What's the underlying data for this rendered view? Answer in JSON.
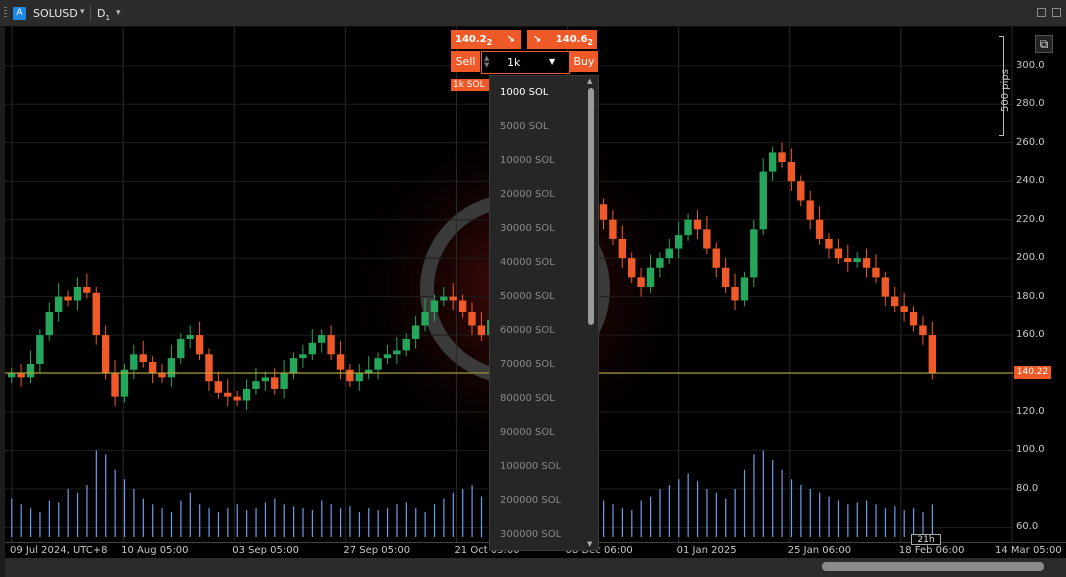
{
  "toolbar": {
    "symbol_icon": "A",
    "symbol": "SOLUSD",
    "symbol_caret": "▾",
    "timeframe": "D",
    "timeframe_sub": "1",
    "timeframe_caret": "▾"
  },
  "colors": {
    "bull": "#26a65b",
    "bear": "#f05a28",
    "volume": "#6d9ee8",
    "current_price_line": "#c6b43a",
    "accent": "#f05a28"
  },
  "trade": {
    "sell_price_main": "140.2",
    "sell_price_sub": "2",
    "buy_price_main": "140.6",
    "buy_price_sub": "2",
    "sell_label": "Sell",
    "buy_label": "Buy",
    "volume_value": "1k",
    "position_badge": "1k SOL",
    "volume_options": [
      "1000 SOL",
      "5000 SOL",
      "10000 SOL",
      "20000 SOL",
      "30000 SOL",
      "40000 SOL",
      "50000 SOL",
      "60000 SOL",
      "70000 SOL",
      "80000 SOL",
      "90000 SOL",
      "100000 SOL",
      "200000 SOL",
      "300000 SOL"
    ],
    "selected_option": "1000 SOL"
  },
  "price_axis": {
    "ticks": [
      "300.0",
      "280.0",
      "260.0",
      "240.0",
      "220.0",
      "200.0",
      "180.0",
      "160.0",
      "140.0",
      "120.0",
      "100.0",
      "80.0",
      "60.0"
    ],
    "current_price": "140.22",
    "pips_label": "500 pips"
  },
  "time_axis": {
    "ticks": [
      "09 Jul 2024, UTC+8",
      "10 Aug 05:00",
      "03 Sep 05:00",
      "27 Sep 05:00",
      "21 Oct 05:00",
      "08 Dec 06:00",
      "01 Jan 2025",
      "25 Jan 06:00",
      "18 Feb 06:00",
      "14 Mar 05:00"
    ],
    "countdown": "21h"
  },
  "chart_data": {
    "type": "candlestick",
    "symbol": "SOLUSD",
    "timeframe": "D1",
    "ylim": [
      55,
      315
    ],
    "current_price": 140.22,
    "close_series": [
      140,
      138,
      145,
      160,
      172,
      180,
      178,
      185,
      182,
      160,
      140,
      128,
      142,
      150,
      146,
      140,
      138,
      148,
      158,
      160,
      150,
      136,
      130,
      128,
      126,
      132,
      136,
      138,
      132,
      140,
      148,
      150,
      156,
      160,
      150,
      142,
      136,
      140,
      142,
      148,
      150,
      152,
      158,
      165,
      172,
      178,
      180,
      178,
      172,
      165,
      160,
      168,
      175,
      185,
      192,
      205,
      210,
      220,
      225,
      230,
      240,
      235,
      228,
      220,
      210,
      200,
      190,
      185,
      195,
      200,
      205,
      212,
      220,
      215,
      205,
      195,
      185,
      178,
      190,
      215,
      245,
      255,
      250,
      240,
      230,
      220,
      210,
      205,
      200,
      198,
      200,
      195,
      190,
      180,
      175,
      172,
      165,
      160,
      140
    ],
    "volume_series": [
      75,
      72,
      70,
      68,
      74,
      73,
      80,
      78,
      82,
      100,
      98,
      90,
      85,
      80,
      75,
      72,
      70,
      68,
      74,
      78,
      72,
      70,
      68,
      70,
      72,
      69,
      70,
      73,
      75,
      72,
      71,
      70,
      69,
      74,
      72,
      70,
      71,
      68,
      70,
      69,
      70,
      72,
      73,
      70,
      68,
      72,
      75,
      78,
      80,
      82,
      76,
      74,
      72,
      70,
      73,
      78,
      82,
      85,
      88,
      86,
      84,
      80,
      78,
      74,
      72,
      70,
      69,
      74,
      76,
      80,
      82,
      85,
      88,
      84,
      80,
      78,
      75,
      80,
      90,
      98,
      100,
      95,
      90,
      85,
      82,
      80,
      78,
      76,
      74,
      72,
      73,
      74,
      72,
      70,
      71,
      69,
      70,
      68,
      72
    ]
  }
}
